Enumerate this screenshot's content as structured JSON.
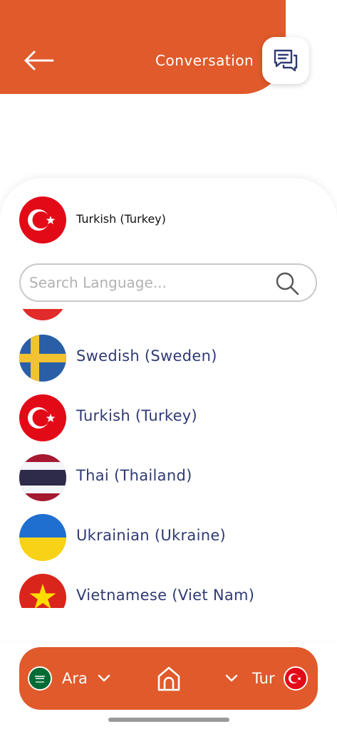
{
  "header": {
    "title": "Conversation",
    "back_icon": "arrow-left-icon",
    "chat_icon": "chat-bubbles-icon",
    "color": "#e05a2b"
  },
  "selected": {
    "label": "Turkish (Turkey)",
    "flag_icon": "turkey-flag-icon"
  },
  "search": {
    "placeholder": "Search Language...",
    "value": "",
    "icon": "search-icon"
  },
  "languages": [
    {
      "label": "Swedish (Sweden)",
      "flag_icon": "sweden-flag-icon"
    },
    {
      "label": "Turkish (Turkey)",
      "flag_icon": "turkey-flag-icon"
    },
    {
      "label": "Thai (Thailand)",
      "flag_icon": "thailand-flag-icon"
    },
    {
      "label": "Ukrainian (Ukraine)",
      "flag_icon": "ukraine-flag-icon"
    },
    {
      "label": "Vietnamese (Viet Nam)",
      "flag_icon": "vietnam-flag-icon"
    }
  ],
  "bottom_bar": {
    "source_lang": "Ara",
    "target_lang": "Tur",
    "source_flag": "saudi-arabia-flag-icon",
    "target_flag": "turkey-flag-icon",
    "home_icon": "home-icon",
    "color": "#e05a2b"
  },
  "colors": {
    "accent": "#e05a2b",
    "text_primary": "#2f3a73"
  }
}
